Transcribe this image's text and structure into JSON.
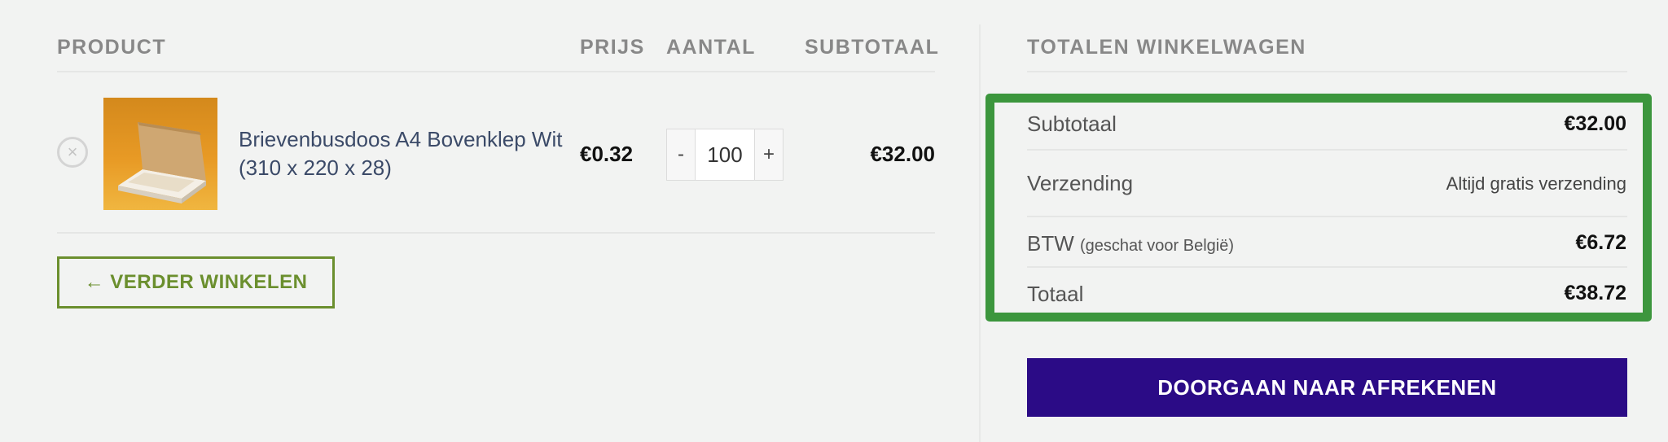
{
  "cart_table": {
    "headers": {
      "product": "PRODUCT",
      "price": "PRIJS",
      "quantity": "AANTAL",
      "subtotal": "SUBTOTAAL"
    },
    "items": [
      {
        "name": "Brievenbusdoos A4 Bovenklep Wit (310 x 220 x 28)",
        "price": "€0.32",
        "quantity": "100",
        "minus": "-",
        "plus": "+",
        "subtotal": "€32.00",
        "remove_icon": "×"
      }
    ]
  },
  "continue_button": {
    "label": "← VERDER WINKELEN"
  },
  "totals": {
    "title": "TOTALEN WINKELWAGEN",
    "subtotal_label": "Subtotaal",
    "subtotal_value": "€32.00",
    "shipping_label": "Verzending",
    "shipping_value": "Altijd gratis verzending",
    "vat_label": "BTW",
    "vat_note": "(geschat voor België)",
    "vat_value": "€6.72",
    "total_label": "Totaal",
    "total_value": "€38.72"
  },
  "checkout_button": {
    "label": "DOORGAAN NAAR AFREKENEN"
  },
  "colors": {
    "accent_green": "#6b8f2e",
    "highlight_box": "#3c963d",
    "checkout_bg": "#2b0b86"
  }
}
